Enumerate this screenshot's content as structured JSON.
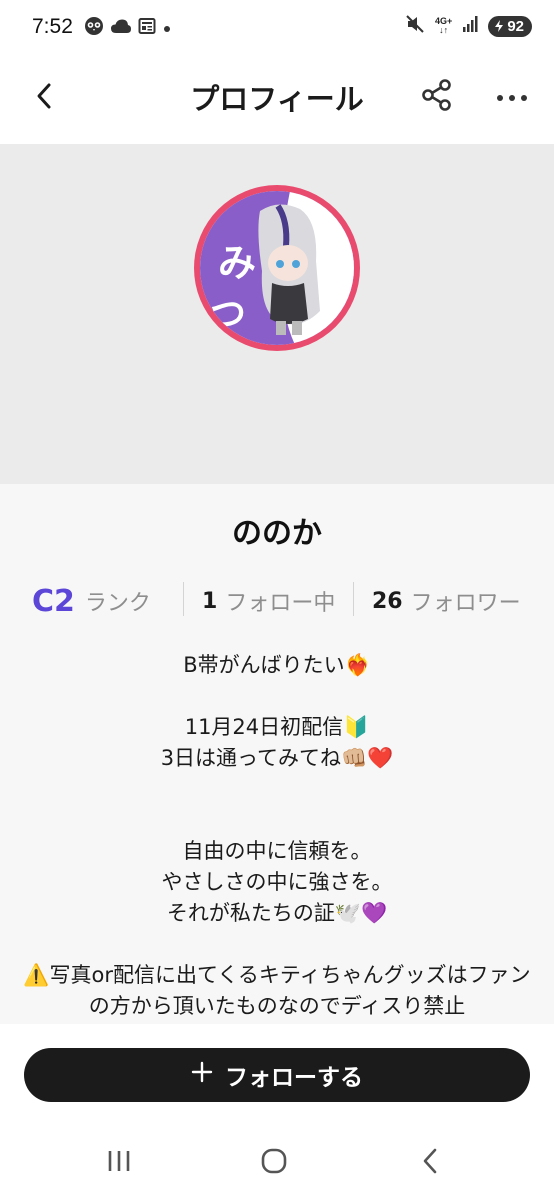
{
  "status_bar": {
    "time": "7:52",
    "network_label": "4G+",
    "battery": "92",
    "icons": [
      "owl-notification-icon",
      "cloud-icon",
      "news-icon",
      "dot-icon",
      "mute-icon",
      "network-arrows-icon",
      "signal-icon",
      "battery-icon"
    ]
  },
  "header": {
    "title": "プロフィール",
    "back_icon": "chevron-left-icon",
    "share_icon": "share-icon",
    "more_icon": "more-dots-icon"
  },
  "profile": {
    "name": "ののか",
    "avatar_ring_color": "#e94b6e",
    "stats": {
      "rank_value": "C2",
      "rank_label": "ランク",
      "following_count": "1",
      "following_label": "フォロー中",
      "followers_count": "26",
      "followers_label": "フォロワー"
    },
    "bio": "B帯がんばりたい❤️‍🔥\n\n11月24日初配信🔰\n3日は通ってみてね👊🏼❤️\n\n\n自由の中に信頼を。\nやさしさの中に強さを。\nそれが私たちの証🕊️💜\n\n⚠️写真or配信に出てくるキティちゃんグッズはファンの方から頂いたものなのでディスり禁止"
  },
  "follow_button": {
    "label": "フォローする",
    "icon": "plus-icon"
  },
  "colors": {
    "accent": "#5b46d8",
    "button_bg": "#1b1b1b",
    "cover_bg": "#ebebeb"
  },
  "nav_bar": {
    "icons": [
      "recent-apps-icon",
      "home-icon",
      "back-icon"
    ]
  }
}
